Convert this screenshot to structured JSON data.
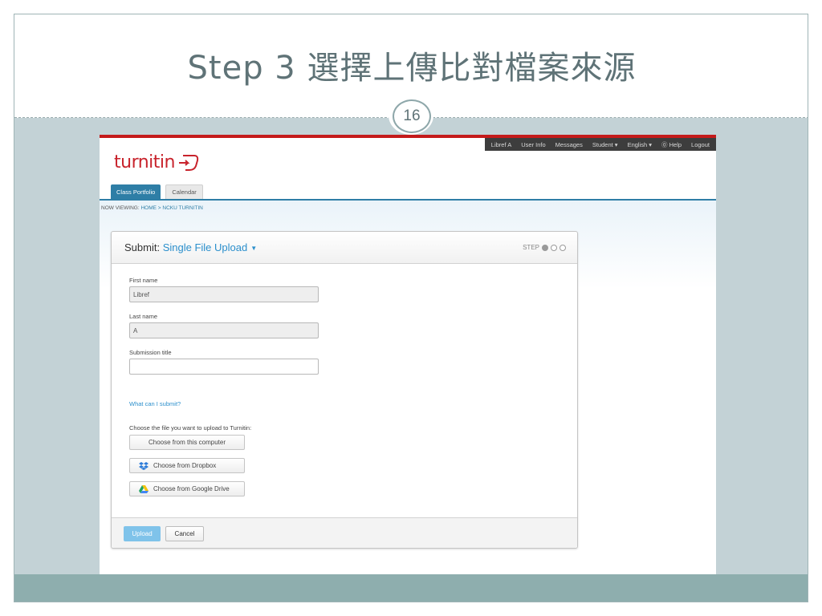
{
  "slide": {
    "title": "Step 3 選擇上傳比對檔案來源",
    "page_number": "16"
  },
  "turnitin": {
    "brand": {
      "logo_prefix": "turn",
      "logo_suffix": "itin",
      "brand_color": "#c8232c"
    },
    "top_nav": {
      "user": "Libref A",
      "user_info": "User Info",
      "messages": "Messages",
      "role": "Student ▾",
      "language": "English ▾",
      "help": "Help",
      "logout": "Logout"
    },
    "tabs": [
      {
        "label": "Class Portfolio",
        "active": true
      },
      {
        "label": "Calendar",
        "active": false
      }
    ],
    "breadcrumb": {
      "prefix": "NOW VIEWING:",
      "home": "HOME",
      "separator": " > ",
      "current": "NCKU TURNITIN"
    },
    "panel": {
      "title_prefix": "Submit:",
      "title_type": "Single File Upload",
      "step_label": "STEP",
      "step_current": 1,
      "step_total": 3,
      "fields": {
        "first_name_label": "First name",
        "first_name_value": "Libref",
        "last_name_label": "Last name",
        "last_name_value": "A",
        "submission_title_label": "Submission title",
        "submission_title_value": ""
      },
      "what_can_submit": "What can I submit?",
      "choose_file_text": "Choose the file you want to upload to Turnitin:",
      "buttons": {
        "computer": "Choose from this computer",
        "dropbox": "Choose from Dropbox",
        "google_drive": "Choose from Google Drive",
        "upload": "Upload",
        "cancel": "Cancel"
      }
    },
    "accent_color": "#2e7ea6",
    "link_color": "#2b8fcc"
  }
}
